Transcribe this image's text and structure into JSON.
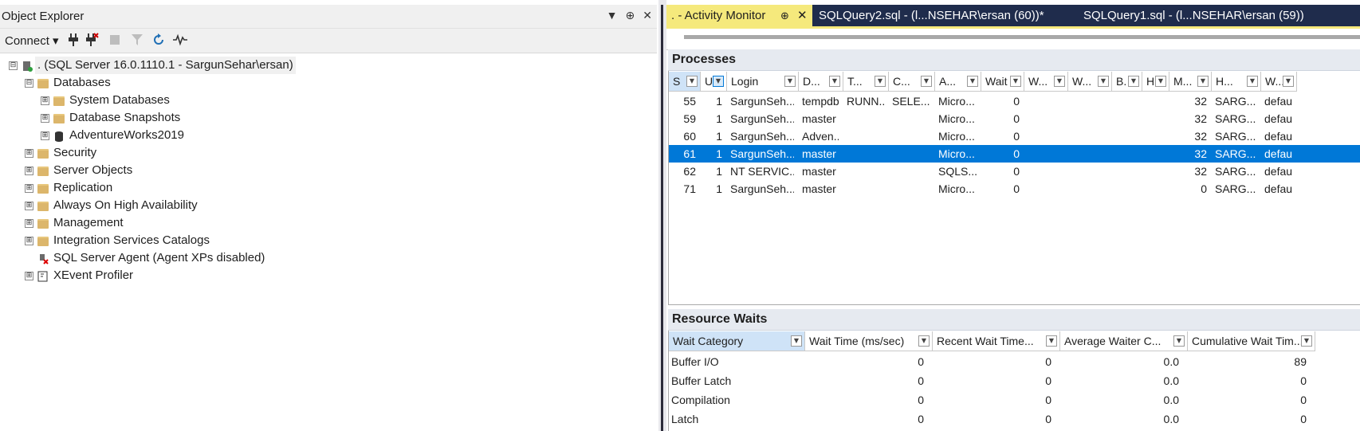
{
  "object_explorer": {
    "title": "Object Explorer",
    "buttons": [
      "▼",
      "⊕",
      "✕"
    ],
    "toolbar": {
      "connect_label": "Connect ▾"
    },
    "tree": [
      {
        "label": ". (SQL Server 16.0.1110.1 - SargunSehar\\ersan)",
        "expander": "⊟",
        "icon": "server-icon"
      },
      {
        "label": "Databases",
        "expander": "⊟",
        "icon": "folder-icon"
      },
      {
        "label": "System Databases",
        "expander": "⊞",
        "icon": "folder-icon"
      },
      {
        "label": "Database Snapshots",
        "expander": "⊞",
        "icon": "folder-icon"
      },
      {
        "label": "AdventureWorks2019",
        "expander": "⊞",
        "icon": "database-icon"
      },
      {
        "label": "Security",
        "expander": "⊞",
        "icon": "folder-icon"
      },
      {
        "label": "Server Objects",
        "expander": "⊞",
        "icon": "folder-icon"
      },
      {
        "label": "Replication",
        "expander": "⊞",
        "icon": "folder-icon"
      },
      {
        "label": "Always On High Availability",
        "expander": "⊞",
        "icon": "folder-icon"
      },
      {
        "label": "Management",
        "expander": "⊞",
        "icon": "folder-icon"
      },
      {
        "label": "Integration Services Catalogs",
        "expander": "⊞",
        "icon": "folder-icon"
      },
      {
        "label": "SQL Server Agent (Agent XPs disabled)",
        "expander": "",
        "icon": "agent-icon"
      },
      {
        "label": "XEvent Profiler",
        "expander": "⊞",
        "icon": "xevent-icon"
      }
    ]
  },
  "tabs": [
    {
      "label": ". - Activity Monitor",
      "active": true
    },
    {
      "label": "SQLQuery2.sql - (l...NSEHAR\\ersan (60))*",
      "active": false
    },
    {
      "label": "SQLQuery1.sql - (l...NSEHAR\\ersan (59))",
      "active": false
    }
  ],
  "processes": {
    "title": "Processes",
    "columns": [
      "S",
      "U",
      "Login",
      "D...",
      "T...",
      "C...",
      "A...",
      "Wait ...",
      "W...",
      "W...",
      "B.",
      "H",
      "M...",
      "H...",
      "W..."
    ],
    "rows": [
      [
        "55",
        "1",
        "SargunSeh...",
        "tempdb",
        "RUNN...",
        "SELE...",
        "Micro...",
        "0",
        "",
        "",
        "",
        "",
        "32",
        "SARG...",
        "defaul"
      ],
      [
        "59",
        "1",
        "SargunSeh...",
        "master",
        "",
        "",
        "Micro...",
        "0",
        "",
        "",
        "",
        "",
        "32",
        "SARG...",
        "defaul"
      ],
      [
        "60",
        "1",
        "SargunSeh...",
        "Adven...",
        "",
        "",
        "Micro...",
        "0",
        "",
        "",
        "",
        "",
        "32",
        "SARG...",
        "defaul"
      ],
      [
        "61",
        "1",
        "SargunSeh...",
        "master",
        "",
        "",
        "Micro...",
        "0",
        "",
        "",
        "",
        "",
        "32",
        "SARG...",
        "defaul"
      ],
      [
        "62",
        "1",
        "NT SERVIC...",
        "master",
        "",
        "",
        "SQLS...",
        "0",
        "",
        "",
        "",
        "",
        "32",
        "SARG...",
        "defaul"
      ],
      [
        "71",
        "1",
        "SargunSeh...",
        "master",
        "",
        "",
        "Micro...",
        "0",
        "",
        "",
        "",
        "",
        "0",
        "SARG...",
        "defaul"
      ]
    ],
    "selected_row": 3
  },
  "resource_waits": {
    "title": "Resource Waits",
    "columns": [
      "Wait Category",
      "Wait Time (ms/sec)",
      "Recent Wait Time...",
      "Average Waiter C...",
      "Cumulative Wait Tim..."
    ],
    "rows": [
      [
        "Buffer I/O",
        "0",
        "0",
        "0.0",
        "89"
      ],
      [
        "Buffer Latch",
        "0",
        "0",
        "0.0",
        "0"
      ],
      [
        "Compilation",
        "0",
        "0",
        "0.0",
        "0"
      ],
      [
        "Latch",
        "0",
        "0",
        "0.0",
        "0"
      ]
    ]
  },
  "colors": {
    "accent": "#0078d7",
    "tab_active": "#f5e97c",
    "tabbar": "#1f2c4c"
  }
}
